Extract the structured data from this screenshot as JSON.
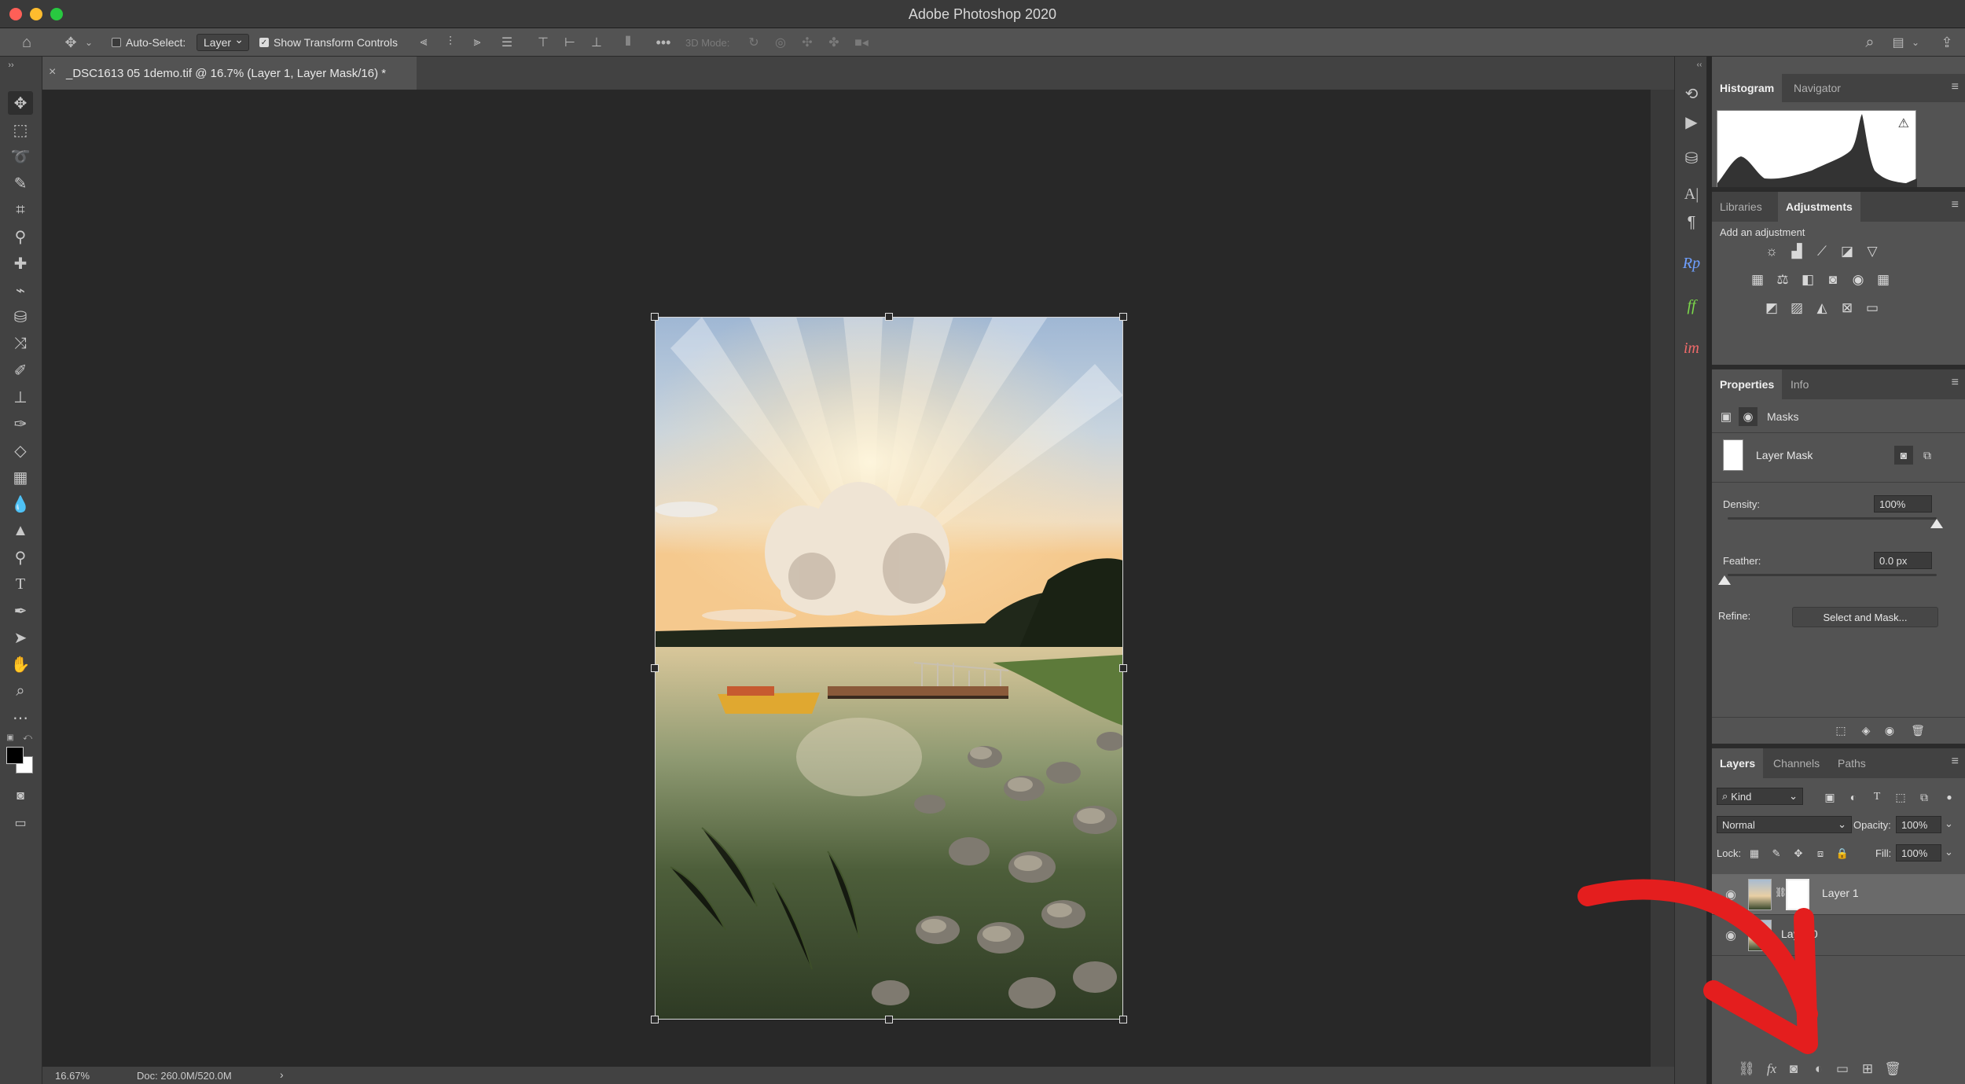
{
  "window": {
    "title": "Adobe Photoshop 2020"
  },
  "options_bar": {
    "auto_select_label": "Auto-Select:",
    "auto_select_checked": false,
    "auto_select_target": "Layer",
    "show_transform_label": "Show Transform Controls",
    "show_transform_checked": true,
    "mode_3d_label": "3D Mode:"
  },
  "document": {
    "tab_title": "_DSC1613 05 1demo.tif @ 16.7% (Layer 1, Layer Mask/16) *"
  },
  "status_bar": {
    "zoom": "16.67%",
    "doc_size": "Doc: 260.0M/520.0M"
  },
  "histogram_panel": {
    "tabs": [
      "Histogram",
      "Navigator"
    ],
    "active_tab": "Histogram",
    "warning_icon": "warning-triangle-icon"
  },
  "adjustments_panel": {
    "tabs": [
      "Libraries",
      "Adjustments"
    ],
    "active_tab": "Adjustments",
    "heading": "Add an adjustment",
    "rows": [
      [
        "brightness-contrast-icon",
        "levels-icon",
        "curves-icon",
        "exposure-icon",
        "vibrance-icon"
      ],
      [
        "hue-saturation-icon",
        "color-balance-icon",
        "black-white-icon",
        "photo-filter-icon",
        "channel-mixer-icon",
        "color-lookup-icon"
      ],
      [
        "invert-icon",
        "posterize-icon",
        "threshold-icon",
        "selective-color-icon",
        "gradient-map-icon"
      ]
    ]
  },
  "properties_panel": {
    "tabs": [
      "Properties",
      "Info"
    ],
    "active_tab": "Properties",
    "section_label": "Masks",
    "mask_name": "Layer Mask",
    "density_label": "Density:",
    "density_value": "100%",
    "density_fraction": 1.0,
    "feather_label": "Feather:",
    "feather_value": "0.0 px",
    "feather_fraction": 0.0,
    "refine_label": "Refine:",
    "select_and_mask_label": "Select and Mask..."
  },
  "layers_panel": {
    "tabs": [
      "Layers",
      "Channels",
      "Paths"
    ],
    "active_tab": "Layers",
    "filter_kind": "Kind",
    "blend_mode": "Normal",
    "opacity_label": "Opacity:",
    "opacity_value": "100%",
    "lock_label": "Lock:",
    "fill_label": "Fill:",
    "fill_value": "100%",
    "layers": [
      {
        "name": "Layer 1",
        "visible": true,
        "has_mask": true,
        "selected": true
      },
      {
        "name": "Layer 0",
        "visible": true,
        "has_mask": false,
        "selected": false
      }
    ]
  },
  "colors": {
    "accent_arrow": "#e41e1e",
    "panel_bg": "#535353",
    "canvas_bg": "#282828"
  }
}
